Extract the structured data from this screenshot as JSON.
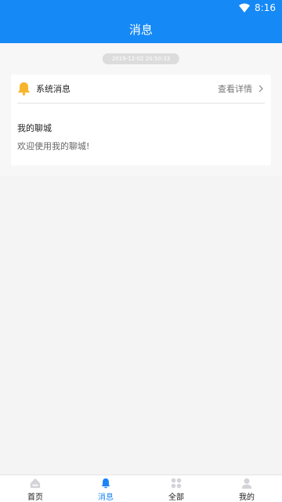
{
  "status_bar": {
    "time": "8:16"
  },
  "header": {
    "title": "消息"
  },
  "message": {
    "timestamp": "2019-12-02 20:50:33",
    "card_title": "系统消息",
    "details_label": "查看详情",
    "subject": "我的聊城",
    "body": "欢迎使用我的聊城!"
  },
  "tabs": [
    {
      "label": "首页",
      "icon": "home-icon",
      "active": false
    },
    {
      "label": "消息",
      "icon": "bell-icon",
      "active": true
    },
    {
      "label": "全部",
      "icon": "grid-icon",
      "active": false
    },
    {
      "label": "我的",
      "icon": "user-icon",
      "active": false
    }
  ],
  "colors": {
    "primary": "#1589f6",
    "bell": "#f7b52c",
    "inactive_icon": "#d3d3d8",
    "background": "#f4f4f4"
  }
}
